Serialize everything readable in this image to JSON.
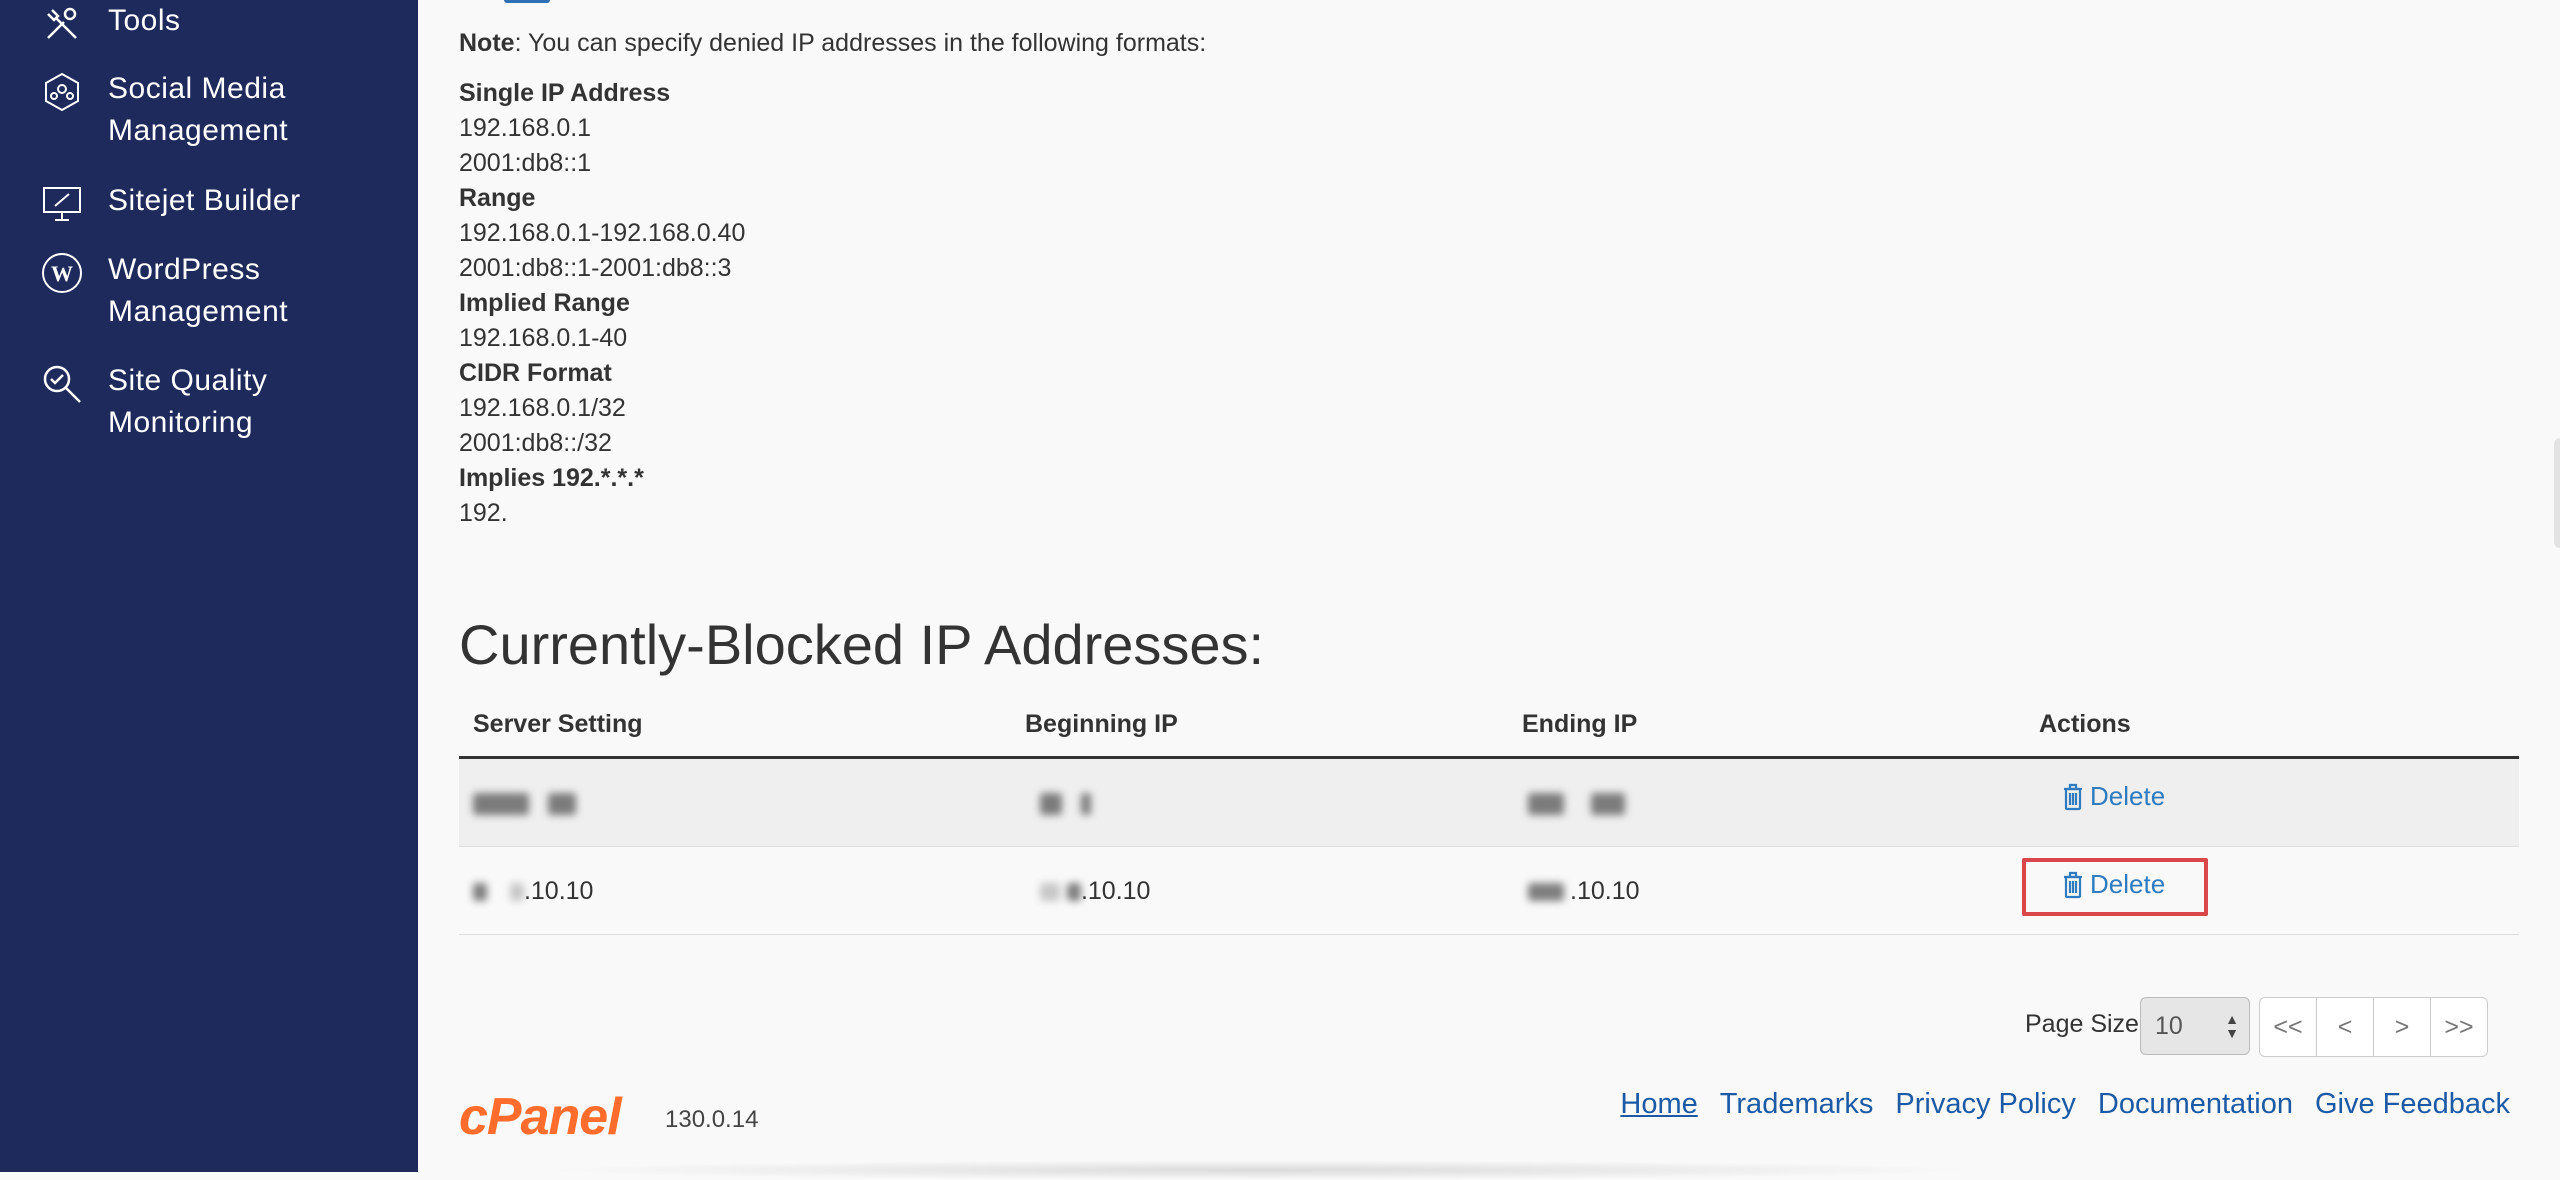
{
  "sidebar": {
    "items": [
      {
        "label": "Tools",
        "icon": "tools-icon"
      },
      {
        "label": "Social Media\nManagement",
        "icon": "social-media-icon"
      },
      {
        "label": "Sitejet Builder",
        "icon": "sitejet-icon"
      },
      {
        "label": "WordPress\nManagement",
        "icon": "wordpress-icon"
      },
      {
        "label": "Site Quality\nMonitoring",
        "icon": "site-quality-icon"
      }
    ]
  },
  "note": {
    "bold": "Note",
    "text": ": You can specify denied IP addresses in the following formats:"
  },
  "formats": [
    {
      "heading": "Single IP Address",
      "examples": [
        "192.168.0.1",
        "2001:db8::1"
      ]
    },
    {
      "heading": "Range",
      "examples": [
        "192.168.0.1-192.168.0.40",
        "2001:db8::1-2001:db8::3"
      ]
    },
    {
      "heading": "Implied Range",
      "examples": [
        "192.168.0.1-40"
      ]
    },
    {
      "heading": "CIDR Format",
      "examples": [
        "192.168.0.1/32",
        "2001:db8::/32"
      ]
    },
    {
      "heading": "Implies 192.*.*.*",
      "examples": [
        "192."
      ]
    }
  ],
  "section_title": "Currently-Blocked IP Addresses:",
  "table": {
    "headers": [
      "Server Setting",
      "Beginning IP",
      "Ending IP",
      "Actions"
    ],
    "rows": [
      {
        "server_setting": "",
        "beginning_ip": "",
        "ending_ip": "",
        "action": "Delete"
      },
      {
        "server_setting": ".10.10",
        "beginning_ip": ".10.10",
        "ending_ip": ".10.10",
        "action": "Delete"
      }
    ]
  },
  "pagination": {
    "page_size_label": "Page Size",
    "page_size_value": "10",
    "buttons": [
      "<<",
      "<",
      ">",
      ">>"
    ]
  },
  "footer": {
    "logo": "cPanel",
    "version": "130.0.14",
    "links": [
      "Home",
      "Trademarks",
      "Privacy Policy",
      "Documentation",
      "Give Feedback"
    ]
  },
  "colors": {
    "sidebar_bg": "#1f2a5c",
    "link": "#2f7bc0",
    "highlight": "#d9474b",
    "logo": "#ff6c2c"
  }
}
